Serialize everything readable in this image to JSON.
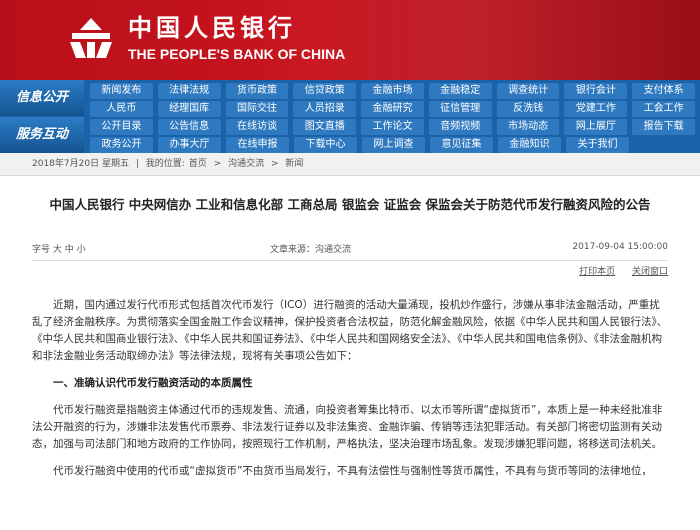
{
  "header": {
    "logo_cn": "中国人民银行",
    "logo_en": "THE PEOPLE'S BANK OF CHINA",
    "logo_icon": "pboc-emblem-icon",
    "brand_color": "#c8151f"
  },
  "nav": {
    "section1": "信息公开",
    "section2": "服务互动",
    "rows": [
      [
        "新闻发布",
        "法律法规",
        "货币政策",
        "信贷政策",
        "金融市场",
        "金融稳定",
        "调查统计",
        "银行会计",
        "支付体系",
        "金融科"
      ],
      [
        "人民币",
        "经理国库",
        "国际交往",
        "人员招录",
        "金融研究",
        "征信管理",
        "反洗钱",
        "党建工作",
        "工会工作",
        "金融标准化"
      ],
      [
        "公开目录",
        "公告信息",
        "在线访谈",
        "图文直播",
        "工作论文",
        "音频视频",
        "市场动态",
        "网上展厅",
        "报告下载",
        "报刊年鉴"
      ],
      [
        "政务公开",
        "办事大厅",
        "在线申报",
        "下载中心",
        "网上调查",
        "意见征集",
        "金融知识",
        "关于我们",
        "",
        ""
      ]
    ],
    "accent": "#1a63a8"
  },
  "breadcrumb": {
    "date": "2018年7月20日 星期五",
    "sep": "|",
    "prefix": "我的位置:",
    "items": [
      "首页",
      "沟通交流",
      "新闻"
    ],
    "sep2": ">"
  },
  "article": {
    "title": "中国人民银行 中央网信办 工业和信息化部 工商总局 银监会 证监会 保监会关于防范代币发行融资风险的公告",
    "fontsize_label": "字号 大 中 小",
    "source": "文章来源：沟通交流",
    "datetime": "2017-09-04 15:00:00",
    "print": "打印本页",
    "close": "关闭窗口",
    "p1": "近期，国内通过发行代币形式包括首次代币发行（ICO）进行融资的活动大量涌现，投机炒作盛行，涉嫌从事非法金融活动，严重扰乱了经济金融秩序。为贯彻落实全国金融工作会议精神，保护投资者合法权益，防范化解金融风险，依据《中华人民共和国人民银行法》、《中华人民共和国商业银行法》、《中华人民共和国证券法》、《中华人民共和国网络安全法》、《中华人民共和国电信条例》、《非法金融机构和非法金融业务活动取缔办法》等法律法规，现将有关事项公告如下：",
    "h1": "一、准确认识代币发行融资活动的本质属性",
    "p2": "代币发行融资是指融资主体通过代币的违规发售、流通，向投资者筹集比特币、以太币等所谓“虚拟货币”，本质上是一种未经批准非法公开融资的行为，涉嫌非法发售代币票券、非法发行证券以及非法集资、金融诈骗、传销等违法犯罪活动。有关部门将密切监测有关动态，加强与司法部门和地方政府的工作协同，按照现行工作机制，严格执法，坚决治理市场乱象。发现涉嫌犯罪问题，将移送司法机关。",
    "p3": "代币发行融资中使用的代币或“虚拟货币”不由货币当局发行，不具有法偿性与强制性等货币属性，不具有与货币等同的法律地位，"
  }
}
